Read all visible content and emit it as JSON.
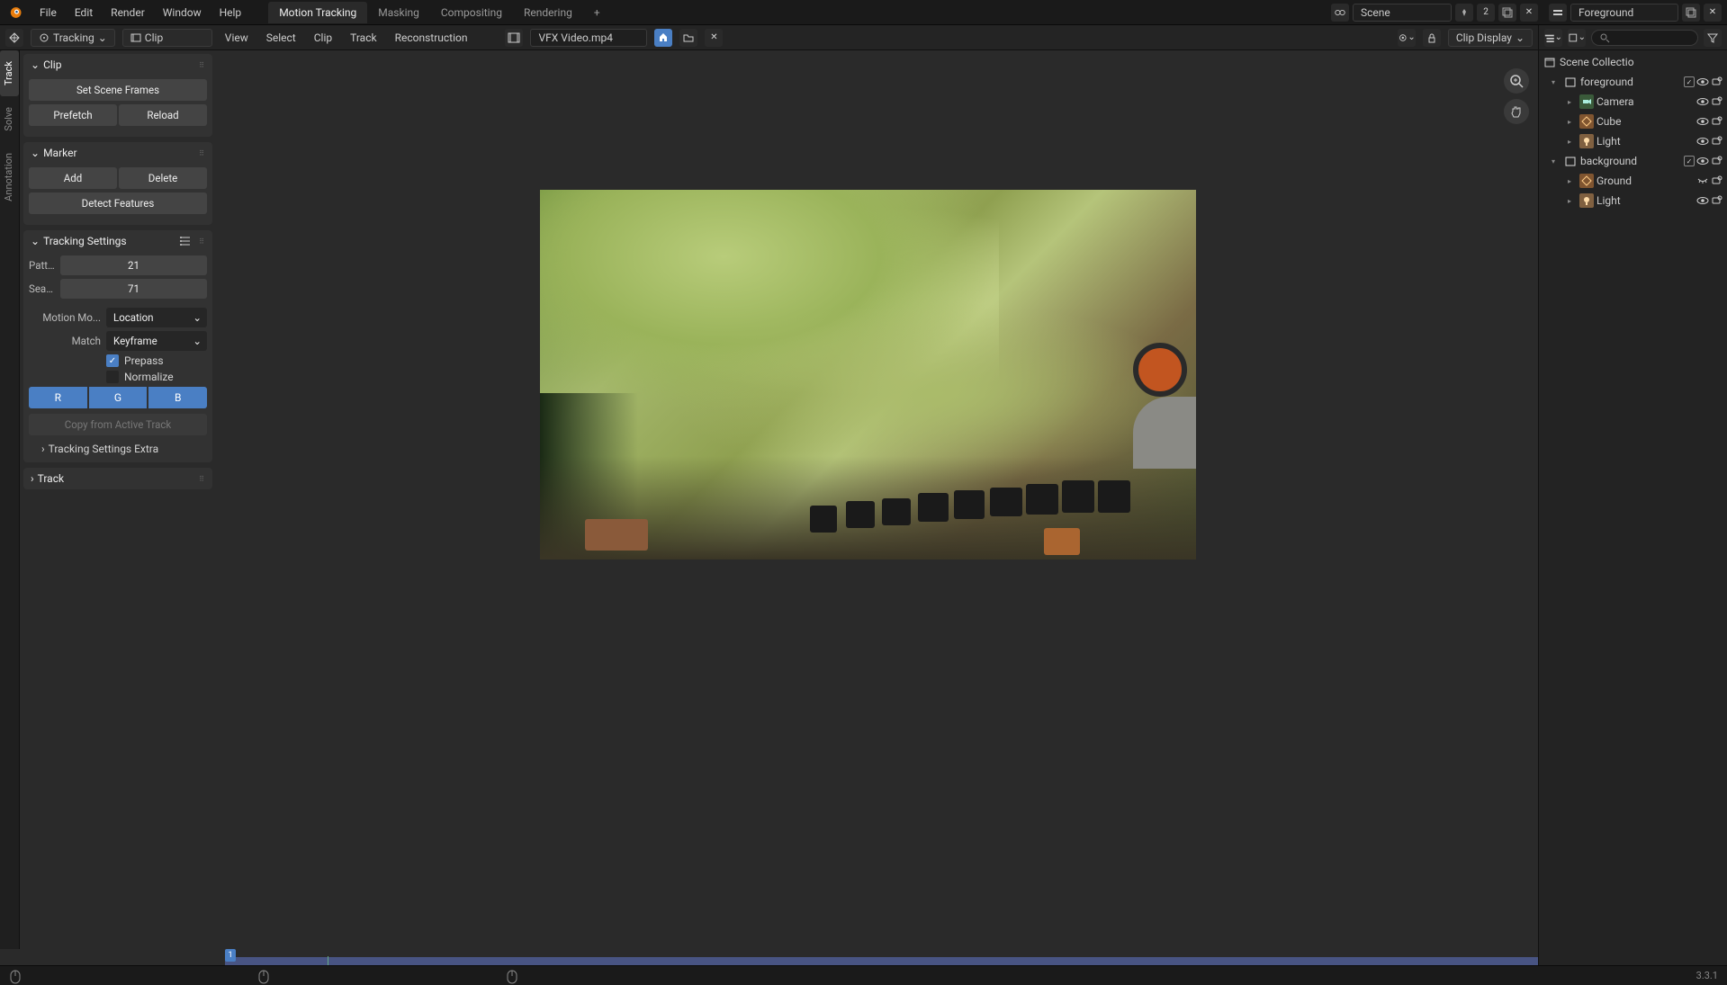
{
  "topbar": {
    "menu": [
      "File",
      "Edit",
      "Render",
      "Window",
      "Help"
    ],
    "workspaces": [
      "Motion Tracking",
      "Masking",
      "Compositing",
      "Rendering"
    ],
    "active_workspace": 0,
    "scene_label": "Scene",
    "scene_users": "2",
    "layer_label": "Foreground"
  },
  "clip_header": {
    "mode": "Tracking",
    "view": "Clip",
    "menus": [
      "View",
      "Select",
      "Clip",
      "Track",
      "Reconstruction"
    ],
    "filename": "VFX Video.mp4",
    "clip_display": "Clip Display"
  },
  "side_tabs": [
    "Track",
    "Solve",
    "Annotation"
  ],
  "panels": {
    "clip": {
      "title": "Clip",
      "set_frames": "Set Scene Frames",
      "prefetch": "Prefetch",
      "reload": "Reload"
    },
    "marker": {
      "title": "Marker",
      "add": "Add",
      "delete": "Delete",
      "detect": "Detect Features"
    },
    "tracking": {
      "title": "Tracking Settings",
      "pattern_label": "Pattern Size",
      "pattern_value": "21",
      "search_label": "Search Size",
      "search_value": "71",
      "motion_label": "Motion Mo...",
      "motion_value": "Location",
      "match_label": "Match",
      "match_value": "Keyframe",
      "prepass": "Prepass",
      "normalize": "Normalize",
      "r": "R",
      "g": "G",
      "b": "B",
      "copy": "Copy from Active Track",
      "extra": "Tracking Settings Extra"
    },
    "track": {
      "title": "Track"
    }
  },
  "timeline": {
    "current_frame": "1"
  },
  "outliner": {
    "scene_collection": "Scene Collectio",
    "items": [
      {
        "name": "foreground",
        "type": "collection",
        "indent": 1,
        "checkbox": true,
        "open": true
      },
      {
        "name": "Camera",
        "type": "camera",
        "indent": 2
      },
      {
        "name": "Cube",
        "type": "mesh",
        "indent": 2
      },
      {
        "name": "Light",
        "type": "light",
        "indent": 2
      },
      {
        "name": "background",
        "type": "collection",
        "indent": 1,
        "checkbox": true,
        "open": true
      },
      {
        "name": "Ground",
        "type": "mesh",
        "indent": 2,
        "hidden": true
      },
      {
        "name": "Light",
        "type": "light",
        "indent": 2
      }
    ]
  },
  "statusbar": {
    "version": "3.3.1"
  }
}
